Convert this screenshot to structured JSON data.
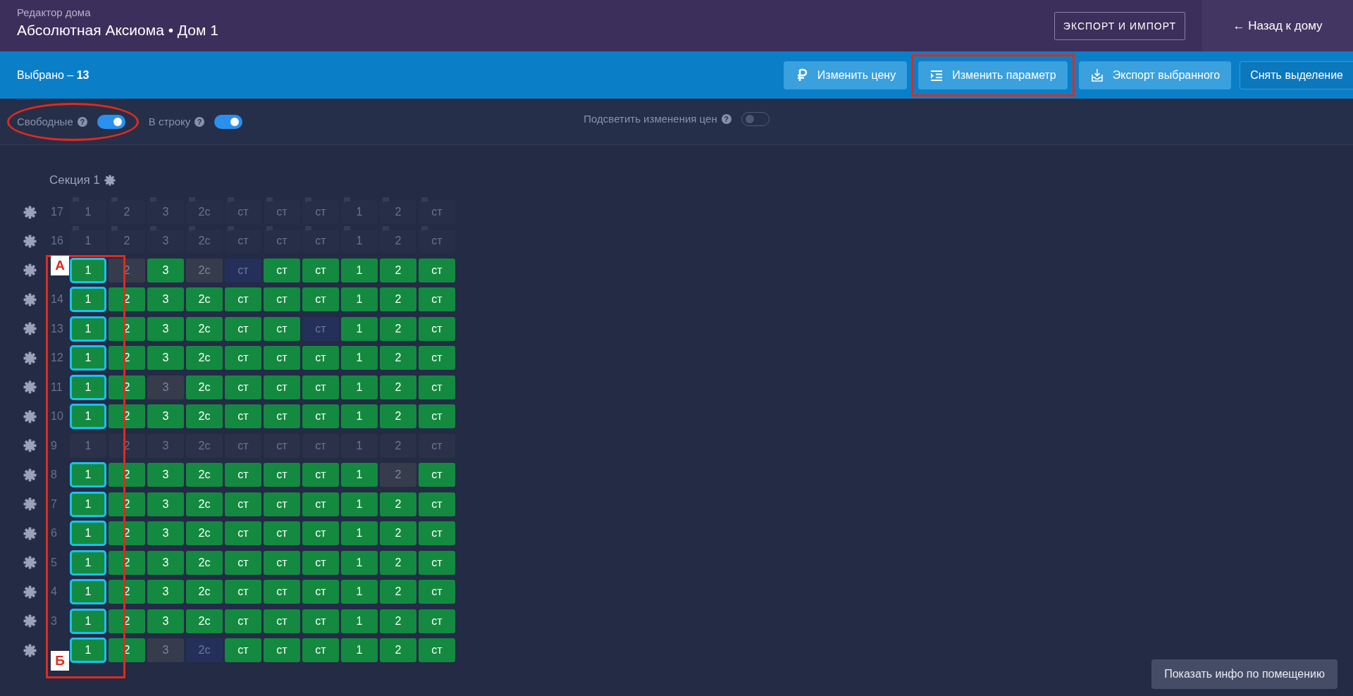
{
  "header": {
    "subtitle": "Редактор дома",
    "title": "Абсолютная Аксиома • Дом 1",
    "export_button": "ЭКСПОРТ И ИМПОРТ",
    "back_link": "← Назад к дому"
  },
  "selection_bar": {
    "label": "Выбрано – **13**",
    "buttons": [
      {
        "label": "Изменить цену",
        "kind": "price",
        "highlighted": false
      },
      {
        "label": "Изменить параметр",
        "kind": "parameter",
        "highlighted": true
      },
      {
        "label": "Экспорт выбранного",
        "kind": "export",
        "highlighted": false
      },
      {
        "label": "Снять выделение",
        "kind": "outline",
        "highlighted": false
      }
    ]
  },
  "toolbar": {
    "left": [
      {
        "label": "Свободные",
        "help": "?",
        "on": true,
        "circled": true
      },
      {
        "label": "В строку",
        "help": "?",
        "on": true,
        "circled": false
      }
    ],
    "center": [
      {
        "label": "Подсветить изменения цен",
        "help": "?",
        "on": false,
        "circled": false
      }
    ]
  },
  "section": {
    "title": "Секция 1",
    "marks": {
      "top": "А",
      "bottom": "Б"
    },
    "floors": [
      {
        "floor": "17",
        "cells": [
          {
            "label": "1",
            "kind": "inactive",
            "selected": false
          },
          {
            "label": "2",
            "kind": "inactive",
            "selected": false
          },
          {
            "label": "3",
            "kind": "inactive",
            "selected": false
          },
          {
            "label": "2с",
            "kind": "inactive",
            "selected": false
          },
          {
            "label": "ст",
            "kind": "inactive",
            "selected": false
          },
          {
            "label": "ст",
            "kind": "inactive",
            "selected": false
          },
          {
            "label": "ст",
            "kind": "inactive",
            "selected": false
          },
          {
            "label": "1",
            "kind": "inactive",
            "selected": false
          },
          {
            "label": "2",
            "kind": "inactive",
            "selected": false
          },
          {
            "label": "ст",
            "kind": "inactive",
            "selected": false
          }
        ]
      },
      {
        "floor": "16",
        "cells": [
          {
            "label": "1",
            "kind": "inactive",
            "selected": false
          },
          {
            "label": "2",
            "kind": "inactive",
            "selected": false
          },
          {
            "label": "3",
            "kind": "inactive",
            "selected": false
          },
          {
            "label": "2с",
            "kind": "inactive",
            "selected": false
          },
          {
            "label": "ст",
            "kind": "inactive",
            "selected": false
          },
          {
            "label": "ст",
            "kind": "inactive",
            "selected": false
          },
          {
            "label": "ст",
            "kind": "inactive",
            "selected": false
          },
          {
            "label": "1",
            "kind": "inactive",
            "selected": false
          },
          {
            "label": "2",
            "kind": "inactive",
            "selected": false
          },
          {
            "label": "ст",
            "kind": "inactive",
            "selected": false
          }
        ]
      },
      {
        "cells": [
          {
            "label": "1",
            "kind": "free",
            "selected": true
          },
          {
            "label": "2",
            "kind": "sold",
            "selected": false
          },
          {
            "label": "3",
            "kind": "free",
            "selected": false
          },
          {
            "label": "2с",
            "kind": "sold",
            "selected": false
          },
          {
            "label": "ст",
            "kind": "empty",
            "selected": false
          },
          {
            "label": "ст",
            "kind": "free",
            "selected": false
          },
          {
            "label": "ст",
            "kind": "free",
            "selected": false
          },
          {
            "label": "1",
            "kind": "free",
            "selected": false
          },
          {
            "label": "2",
            "kind": "free",
            "selected": false
          },
          {
            "label": "ст",
            "kind": "free",
            "selected": false
          }
        ]
      },
      {
        "floor": "14",
        "cells": [
          {
            "label": "1",
            "kind": "free",
            "selected": true
          },
          {
            "label": "2",
            "kind": "free",
            "selected": false
          },
          {
            "label": "3",
            "kind": "free",
            "selected": false
          },
          {
            "label": "2с",
            "kind": "free",
            "selected": false
          },
          {
            "label": "ст",
            "kind": "free",
            "selected": false
          },
          {
            "label": "ст",
            "kind": "free",
            "selected": false
          },
          {
            "label": "ст",
            "kind": "free",
            "selected": false
          },
          {
            "label": "1",
            "kind": "free",
            "selected": false
          },
          {
            "label": "2",
            "kind": "free",
            "selected": false
          },
          {
            "label": "ст",
            "kind": "free",
            "selected": false
          }
        ]
      },
      {
        "floor": "13",
        "cells": [
          {
            "label": "1",
            "kind": "free",
            "selected": true
          },
          {
            "label": "2",
            "kind": "free",
            "selected": false
          },
          {
            "label": "3",
            "kind": "free",
            "selected": false
          },
          {
            "label": "2с",
            "kind": "free",
            "selected": false
          },
          {
            "label": "ст",
            "kind": "free",
            "selected": false
          },
          {
            "label": "ст",
            "kind": "free",
            "selected": false
          },
          {
            "label": "ст",
            "kind": "empty",
            "selected": false
          },
          {
            "label": "1",
            "kind": "free",
            "selected": false
          },
          {
            "label": "2",
            "kind": "free",
            "selected": false
          },
          {
            "label": "ст",
            "kind": "free",
            "selected": false
          }
        ]
      },
      {
        "floor": "12",
        "cells": [
          {
            "label": "1",
            "kind": "free",
            "selected": true
          },
          {
            "label": "2",
            "kind": "free",
            "selected": false
          },
          {
            "label": "3",
            "kind": "free",
            "selected": false
          },
          {
            "label": "2с",
            "kind": "free",
            "selected": false
          },
          {
            "label": "ст",
            "kind": "free",
            "selected": false
          },
          {
            "label": "ст",
            "kind": "free",
            "selected": false
          },
          {
            "label": "ст",
            "kind": "free",
            "selected": false
          },
          {
            "label": "1",
            "kind": "free",
            "selected": false
          },
          {
            "label": "2",
            "kind": "free",
            "selected": false
          },
          {
            "label": "ст",
            "kind": "free",
            "selected": false
          }
        ]
      },
      {
        "floor": "11",
        "cells": [
          {
            "label": "1",
            "kind": "free",
            "selected": true
          },
          {
            "label": "2",
            "kind": "free",
            "selected": false
          },
          {
            "label": "3",
            "kind": "sold",
            "selected": false
          },
          {
            "label": "2с",
            "kind": "free",
            "selected": false
          },
          {
            "label": "ст",
            "kind": "free",
            "selected": false
          },
          {
            "label": "ст",
            "kind": "free",
            "selected": false
          },
          {
            "label": "ст",
            "kind": "free",
            "selected": false
          },
          {
            "label": "1",
            "kind": "free",
            "selected": false
          },
          {
            "label": "2",
            "kind": "free",
            "selected": false
          },
          {
            "label": "ст",
            "kind": "free",
            "selected": false
          }
        ]
      },
      {
        "floor": "10",
        "cells": [
          {
            "label": "1",
            "kind": "free",
            "selected": true
          },
          {
            "label": "2",
            "kind": "free",
            "selected": false
          },
          {
            "label": "3",
            "kind": "free",
            "selected": false
          },
          {
            "label": "2с",
            "kind": "free",
            "selected": false
          },
          {
            "label": "ст",
            "kind": "free",
            "selected": false
          },
          {
            "label": "ст",
            "kind": "free",
            "selected": false
          },
          {
            "label": "ст",
            "kind": "free",
            "selected": false
          },
          {
            "label": "1",
            "kind": "free",
            "selected": false
          },
          {
            "label": "2",
            "kind": "free",
            "selected": false
          },
          {
            "label": "ст",
            "kind": "free",
            "selected": false
          }
        ]
      },
      {
        "floor": "9",
        "cells": [
          {
            "label": "1",
            "kind": "closed",
            "selected": false
          },
          {
            "label": "2",
            "kind": "closed",
            "selected": false
          },
          {
            "label": "3",
            "kind": "closed",
            "selected": false
          },
          {
            "label": "2с",
            "kind": "closed",
            "selected": false
          },
          {
            "label": "ст",
            "kind": "closed",
            "selected": false
          },
          {
            "label": "ст",
            "kind": "closed",
            "selected": false
          },
          {
            "label": "ст",
            "kind": "closed",
            "selected": false
          },
          {
            "label": "1",
            "kind": "closed",
            "selected": false
          },
          {
            "label": "2",
            "kind": "closed",
            "selected": false
          },
          {
            "label": "ст",
            "kind": "closed",
            "selected": false
          }
        ]
      },
      {
        "floor": "8",
        "cells": [
          {
            "label": "1",
            "kind": "free",
            "selected": true
          },
          {
            "label": "2",
            "kind": "free",
            "selected": false
          },
          {
            "label": "3",
            "kind": "free",
            "selected": false
          },
          {
            "label": "2с",
            "kind": "free",
            "selected": false
          },
          {
            "label": "ст",
            "kind": "free",
            "selected": false
          },
          {
            "label": "ст",
            "kind": "free",
            "selected": false
          },
          {
            "label": "ст",
            "kind": "free",
            "selected": false
          },
          {
            "label": "1",
            "kind": "free",
            "selected": false
          },
          {
            "label": "2",
            "kind": "sold",
            "selected": false
          },
          {
            "label": "ст",
            "kind": "free",
            "selected": false
          }
        ]
      },
      {
        "floor": "7",
        "cells": [
          {
            "label": "1",
            "kind": "free",
            "selected": true
          },
          {
            "label": "2",
            "kind": "free",
            "selected": false
          },
          {
            "label": "3",
            "kind": "free",
            "selected": false
          },
          {
            "label": "2с",
            "kind": "free",
            "selected": false
          },
          {
            "label": "ст",
            "kind": "free",
            "selected": false
          },
          {
            "label": "ст",
            "kind": "free",
            "selected": false
          },
          {
            "label": "ст",
            "kind": "free",
            "selected": false
          },
          {
            "label": "1",
            "kind": "free",
            "selected": false
          },
          {
            "label": "2",
            "kind": "free",
            "selected": false
          },
          {
            "label": "ст",
            "kind": "free",
            "selected": false
          }
        ]
      },
      {
        "floor": "6",
        "cells": [
          {
            "label": "1",
            "kind": "free",
            "selected": true
          },
          {
            "label": "2",
            "kind": "free",
            "selected": false
          },
          {
            "label": "3",
            "kind": "free",
            "selected": false
          },
          {
            "label": "2с",
            "kind": "free",
            "selected": false
          },
          {
            "label": "ст",
            "kind": "free",
            "selected": false
          },
          {
            "label": "ст",
            "kind": "free",
            "selected": false
          },
          {
            "label": "ст",
            "kind": "free",
            "selected": false
          },
          {
            "label": "1",
            "kind": "free",
            "selected": false
          },
          {
            "label": "2",
            "kind": "free",
            "selected": false
          },
          {
            "label": "ст",
            "kind": "free",
            "selected": false
          }
        ]
      },
      {
        "floor": "5",
        "cells": [
          {
            "label": "1",
            "kind": "free",
            "selected": true
          },
          {
            "label": "2",
            "kind": "free",
            "selected": false
          },
          {
            "label": "3",
            "kind": "free",
            "selected": false
          },
          {
            "label": "2с",
            "kind": "free",
            "selected": false
          },
          {
            "label": "ст",
            "kind": "free",
            "selected": false
          },
          {
            "label": "ст",
            "kind": "free",
            "selected": false
          },
          {
            "label": "ст",
            "kind": "free",
            "selected": false
          },
          {
            "label": "1",
            "kind": "free",
            "selected": false
          },
          {
            "label": "2",
            "kind": "free",
            "selected": false
          },
          {
            "label": "ст",
            "kind": "free",
            "selected": false
          }
        ]
      },
      {
        "floor": "4",
        "cells": [
          {
            "label": "1",
            "kind": "free",
            "selected": true
          },
          {
            "label": "2",
            "kind": "free",
            "selected": false
          },
          {
            "label": "3",
            "kind": "free",
            "selected": false
          },
          {
            "label": "2с",
            "kind": "free",
            "selected": false
          },
          {
            "label": "ст",
            "kind": "free",
            "selected": false
          },
          {
            "label": "ст",
            "kind": "free",
            "selected": false
          },
          {
            "label": "ст",
            "kind": "free",
            "selected": false
          },
          {
            "label": "1",
            "kind": "free",
            "selected": false
          },
          {
            "label": "2",
            "kind": "free",
            "selected": false
          },
          {
            "label": "ст",
            "kind": "free",
            "selected": false
          }
        ]
      },
      {
        "floor": "3",
        "cells": [
          {
            "label": "1",
            "kind": "free",
            "selected": true
          },
          {
            "label": "2",
            "kind": "free",
            "selected": false
          },
          {
            "label": "3",
            "kind": "free",
            "selected": false
          },
          {
            "label": "2с",
            "kind": "free",
            "selected": false
          },
          {
            "label": "ст",
            "kind": "free",
            "selected": false
          },
          {
            "label": "ст",
            "kind": "free",
            "selected": false
          },
          {
            "label": "ст",
            "kind": "free",
            "selected": false
          },
          {
            "label": "1",
            "kind": "free",
            "selected": false
          },
          {
            "label": "2",
            "kind": "free",
            "selected": false
          },
          {
            "label": "ст",
            "kind": "free",
            "selected": false
          }
        ]
      },
      {
        "cells": [
          {
            "label": "1",
            "kind": "free",
            "selected": true
          },
          {
            "label": "2",
            "kind": "free",
            "selected": false
          },
          {
            "label": "3",
            "kind": "sold",
            "selected": false
          },
          {
            "label": "2с",
            "kind": "empty",
            "selected": false
          },
          {
            "label": "ст",
            "kind": "free",
            "selected": false
          },
          {
            "label": "ст",
            "kind": "free",
            "selected": false
          },
          {
            "label": "ст",
            "kind": "free",
            "selected": false
          },
          {
            "label": "1",
            "kind": "free",
            "selected": false
          },
          {
            "label": "2",
            "kind": "free",
            "selected": false
          },
          {
            "label": "ст",
            "kind": "free",
            "selected": false
          }
        ]
      }
    ]
  },
  "info_button": "Показать инфо по помещению"
}
